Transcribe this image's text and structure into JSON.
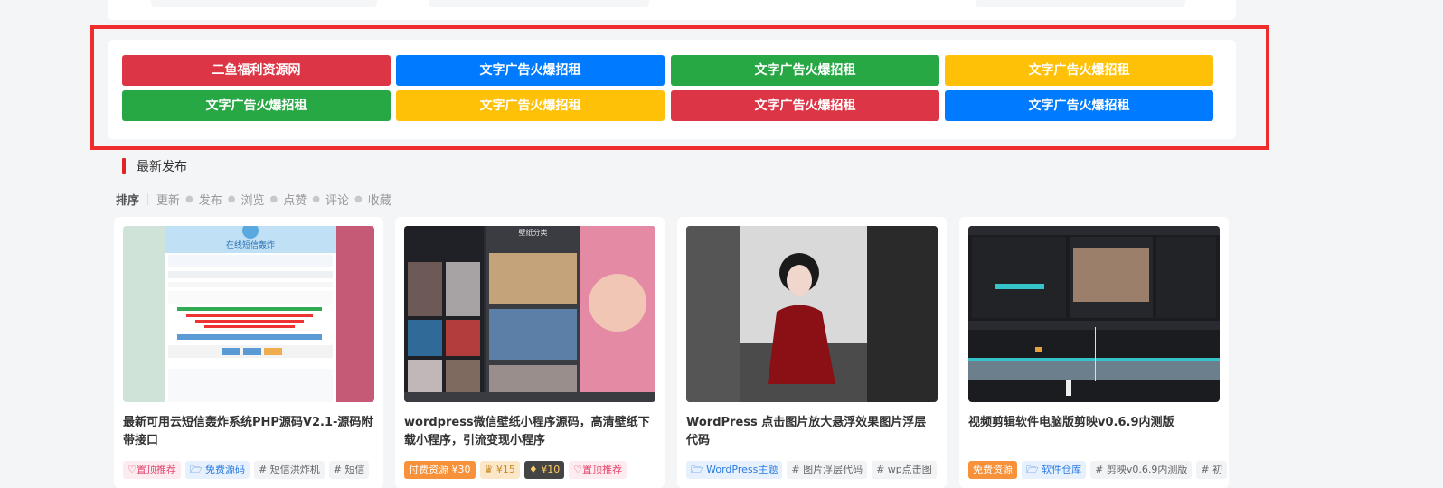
{
  "ads": [
    {
      "label": "二鱼福利资源网",
      "color": "#dc3545"
    },
    {
      "label": "文字广告火爆招租",
      "color": "#007bff"
    },
    {
      "label": "文字广告火爆招租",
      "color": "#28a745"
    },
    {
      "label": "文字广告火爆招租",
      "color": "#ffc107"
    },
    {
      "label": "文字广告火爆招租",
      "color": "#28a745"
    },
    {
      "label": "文字广告火爆招租",
      "color": "#ffc107"
    },
    {
      "label": "文字广告火爆招租",
      "color": "#dc3545"
    },
    {
      "label": "文字广告火爆招租",
      "color": "#007bff"
    }
  ],
  "section": {
    "title": "最新发布"
  },
  "sort": {
    "label": "排序",
    "items": [
      "更新",
      "发布",
      "浏览",
      "点赞",
      "评论",
      "收藏"
    ]
  },
  "posts": [
    {
      "title": "最新可用云短信轰炸系统PHP源码V2.1-源码附带接口",
      "thumb_heading": "在线短信轰炸",
      "tags": [
        {
          "text": "♡置顶推荐",
          "style": "pink"
        },
        {
          "text": "🗁 免费源码",
          "style": "blue"
        },
        {
          "text": "# 短信洪炸机",
          "style": "gray"
        },
        {
          "text": "# 短信",
          "style": "gray"
        }
      ]
    },
    {
      "title": "wordpress微信壁纸小程序源码，高清壁纸下载小程序，引流变现小程序",
      "thumb_heading": "壁纸分类",
      "tags": [
        {
          "text": "付费资源 ¥30",
          "style": "orange"
        },
        {
          "text": "♛ ¥15",
          "style": "gold"
        },
        {
          "text": "♦ ¥10",
          "style": "dark"
        },
        {
          "text": "♡置顶推荐",
          "style": "pink"
        }
      ]
    },
    {
      "title": "WordPress 点击图片放大悬浮效果图片浮层代码",
      "tags": [
        {
          "text": "🗁 WordPress主题",
          "style": "blue"
        },
        {
          "text": "# 图片浮层代码",
          "style": "gray"
        },
        {
          "text": "# wp点击图",
          "style": "gray"
        }
      ]
    },
    {
      "title": "视频剪辑软件电脑版剪映v0.6.9内测版",
      "tags": [
        {
          "text": "免费资源",
          "style": "orange-solid"
        },
        {
          "text": "🗁 软件仓库",
          "style": "blue"
        },
        {
          "text": "# 剪映v0.6.9内测版",
          "style": "gray"
        },
        {
          "text": "# 初",
          "style": "gray"
        }
      ]
    }
  ]
}
